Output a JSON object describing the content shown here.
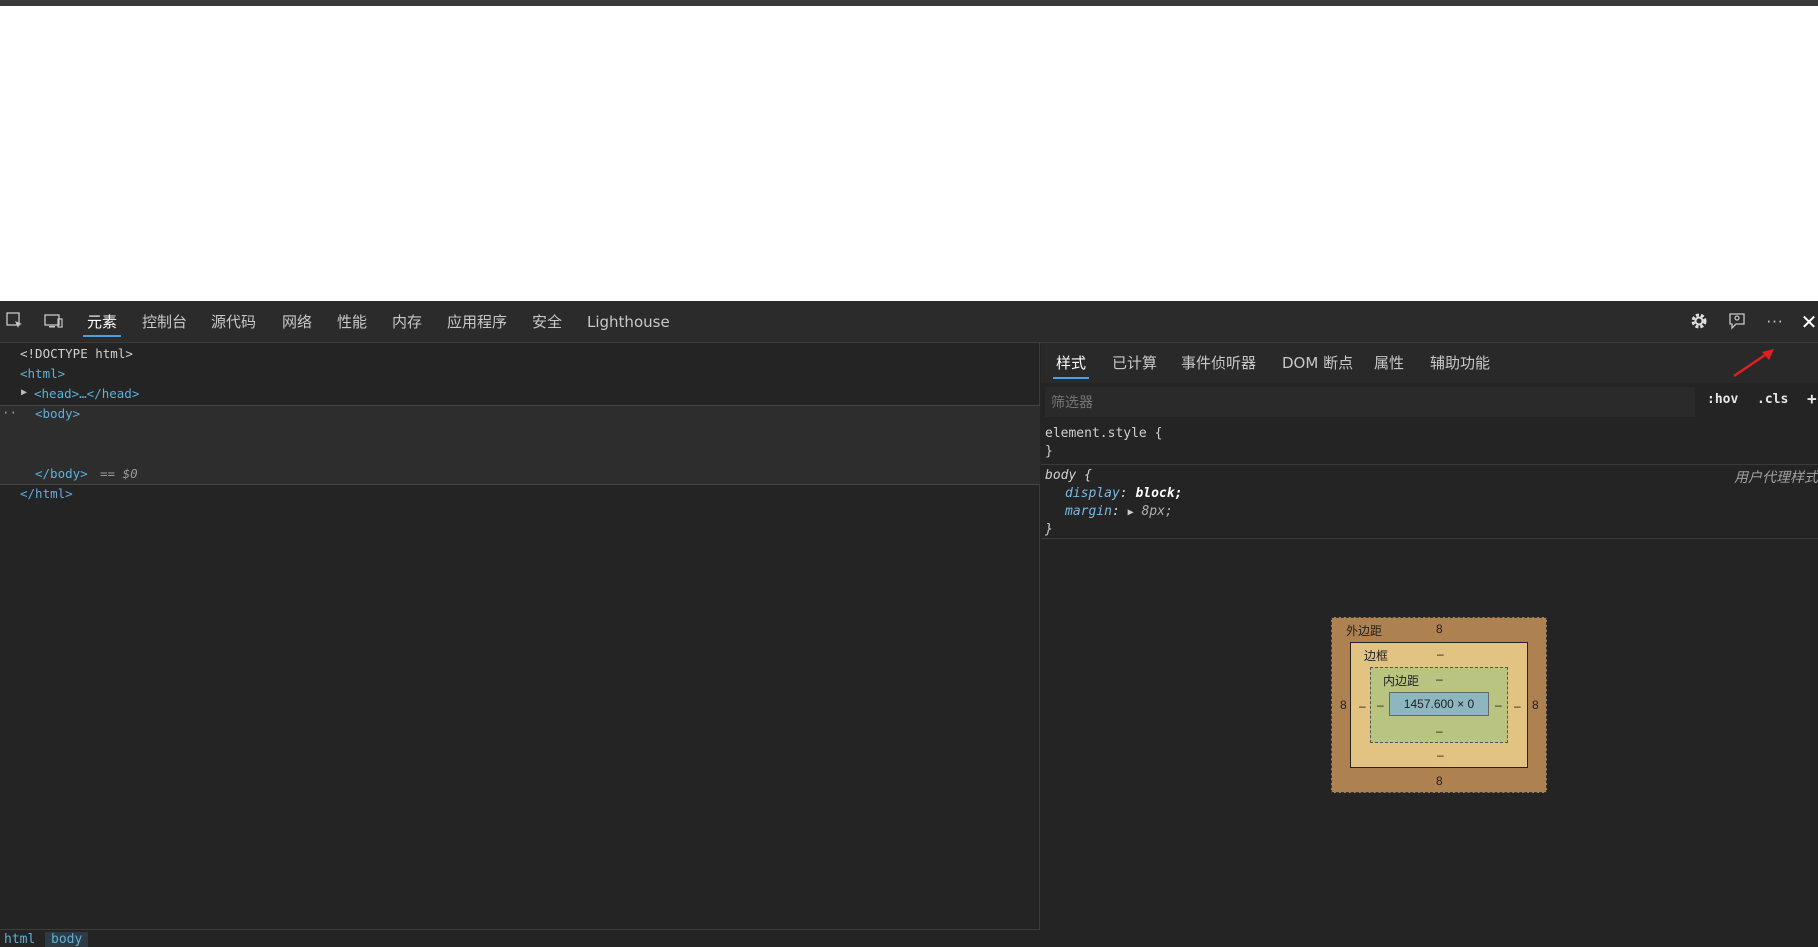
{
  "devtools": {
    "tabs": [
      "元素",
      "控制台",
      "源代码",
      "网络",
      "性能",
      "内存",
      "应用程序",
      "安全",
      "Lighthouse"
    ],
    "active_tab": "元素"
  },
  "elements_tree": {
    "doctype": "<!DOCTYPE html>",
    "html_open": "<html>",
    "head": "<head>…</head>",
    "body_open": "<body>",
    "body_close": "</body>",
    "selected_marker": "== $0",
    "html_close": "</html>",
    "dots": "··"
  },
  "breadcrumb": [
    "html",
    "body"
  ],
  "styles_panel": {
    "subtabs": [
      "样式",
      "已计算",
      "事件侦听器",
      "DOM 断点",
      "属性",
      "辅助功能"
    ],
    "active_subtab": "样式",
    "filter_placeholder": "筛选器",
    "hov": ":hov",
    "cls": ".cls",
    "plus": "+",
    "element_style_open": "element.style {",
    "close_brace": "}",
    "body_rule_selector": "body {",
    "user_agent_label": "用户代理样式",
    "decl1_prop": "display",
    "decl1_val": "block;",
    "decl2_prop": "margin",
    "decl2_val": "8px;"
  },
  "box_model": {
    "margin_label": "外边距",
    "border_label": "边框",
    "padding_label": "内边距",
    "margin_top": "8",
    "margin_bottom": "8",
    "margin_left": "8",
    "margin_right": "8",
    "border_top": "–",
    "border_bottom": "–",
    "border_left": "–",
    "border_right": "–",
    "padding_top": "–",
    "padding_bottom": "–",
    "padding_left": "–",
    "padding_right": "–",
    "content": "1457.600 × 0"
  },
  "colors": {
    "accent": "#4ca0e0",
    "tag": "#5db0d7",
    "annotation_arrow": "#e02020"
  }
}
